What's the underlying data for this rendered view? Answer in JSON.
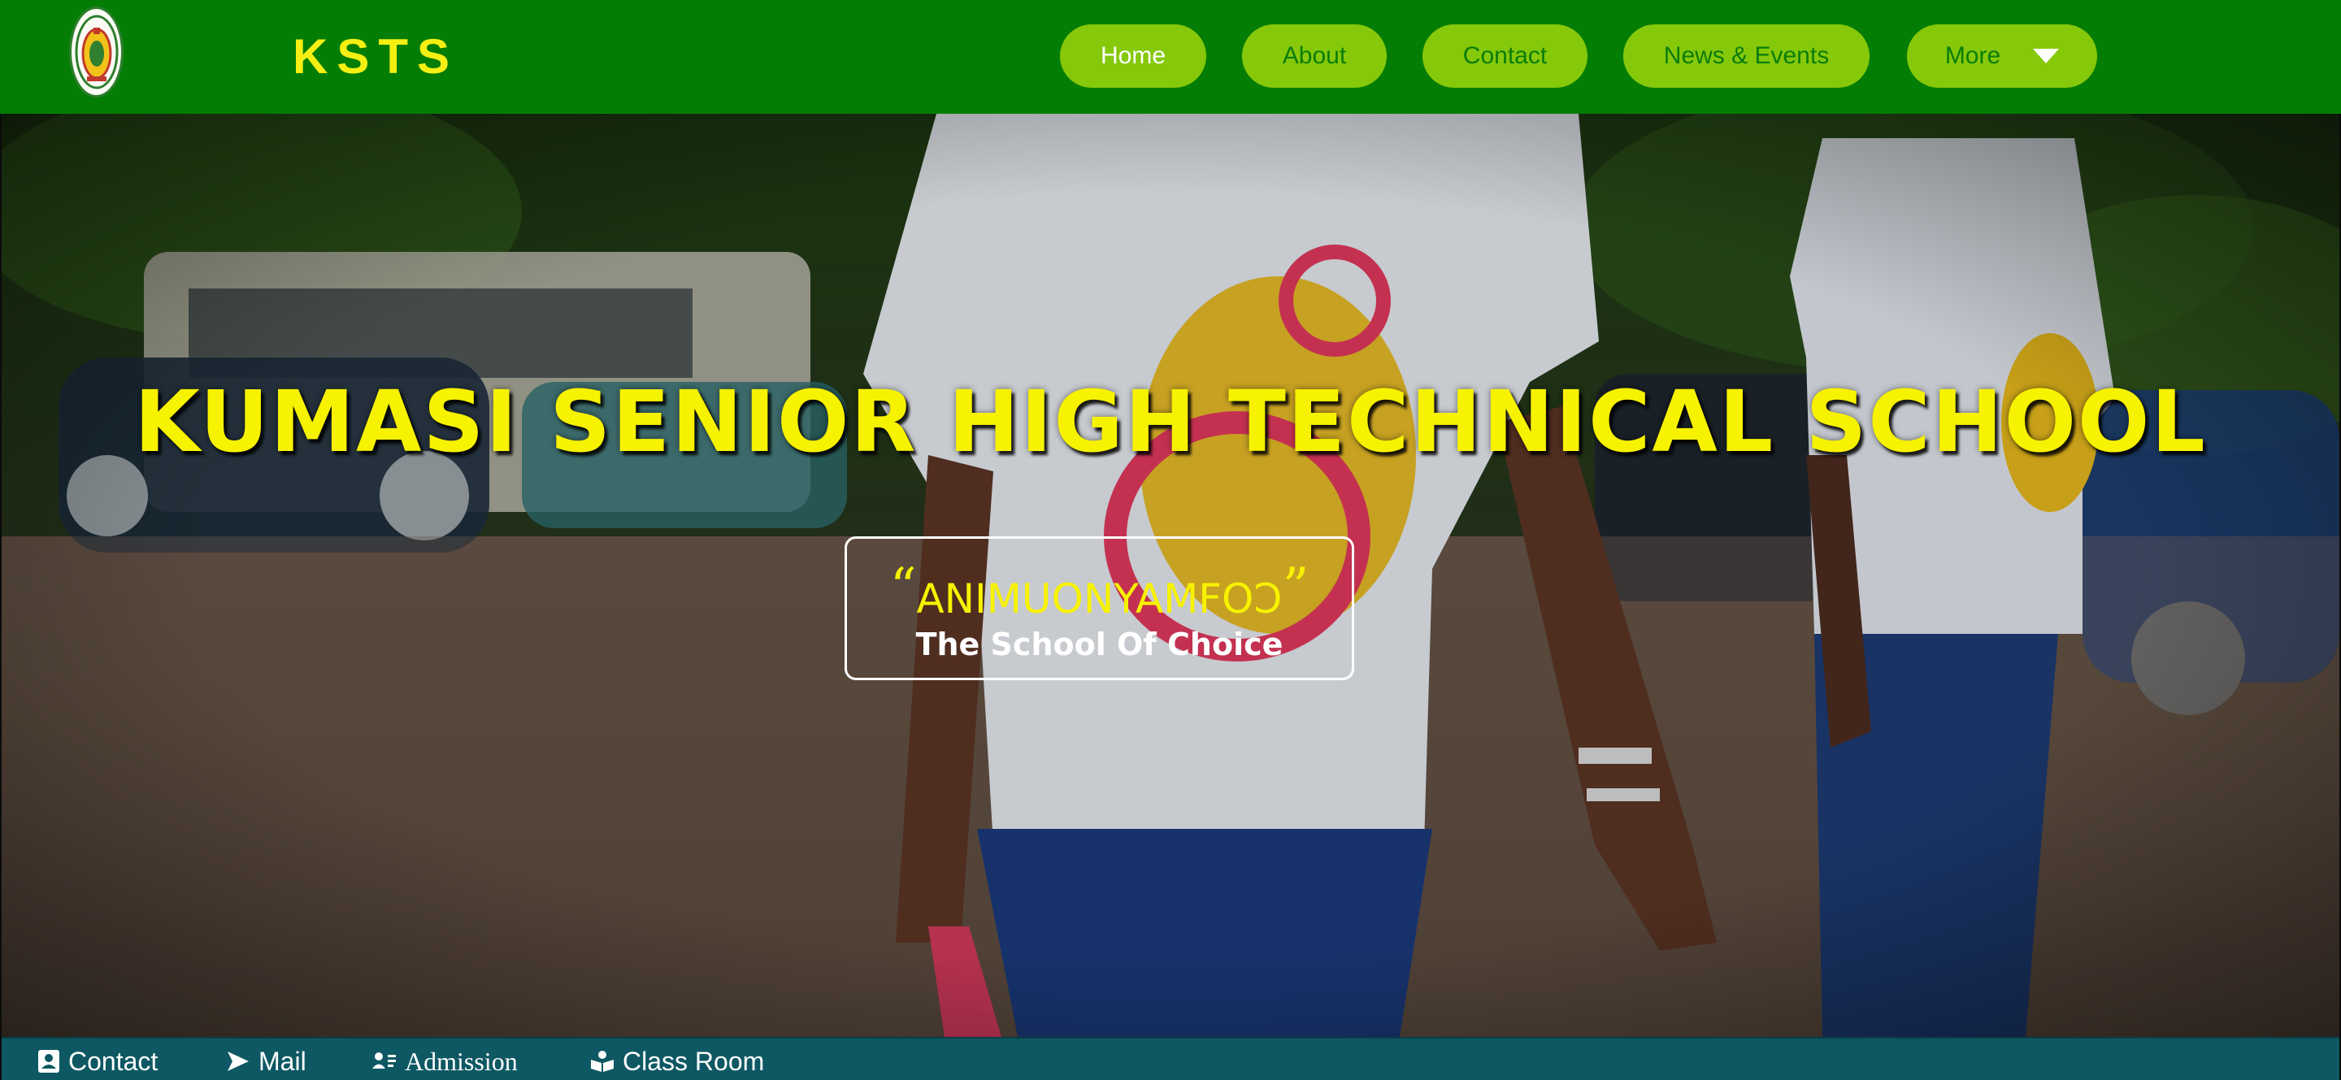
{
  "header": {
    "logo_icon": "school-crest-icon",
    "brand": "KSTS",
    "nav": [
      {
        "label": "Home",
        "active": true
      },
      {
        "label": "About",
        "active": false
      },
      {
        "label": "Contact",
        "active": false
      },
      {
        "label": "News & Events",
        "active": false
      },
      {
        "label": "More",
        "active": false,
        "icon": "caret-down-icon"
      }
    ]
  },
  "hero": {
    "title": "KUMASI SENIOR HIGH TECHNICAL SCHOOL",
    "motto": "ANIMUONYAMFOƆ",
    "tagline": "The School Of Choice"
  },
  "bottom_bar": {
    "items": [
      {
        "label": "Contact",
        "icon": "contact-card-icon"
      },
      {
        "label": "Mail",
        "icon": "send-icon"
      },
      {
        "label": "Admission",
        "icon": "user-list-icon"
      },
      {
        "label": "Class Room",
        "icon": "open-book-icon"
      }
    ]
  },
  "colors": {
    "header_bg": "#047d04",
    "brand_yellow": "#f5ef13",
    "nav_button": "#86c80a",
    "bottom_bar": "#0d5863"
  }
}
